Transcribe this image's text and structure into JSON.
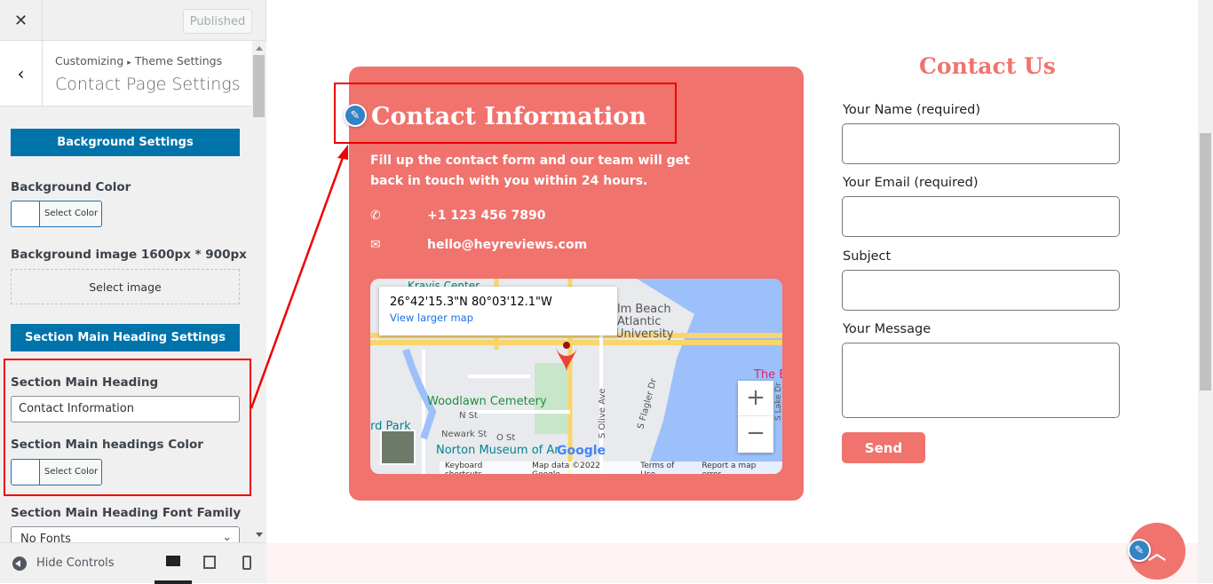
{
  "sidebar": {
    "close_icon": "close-icon",
    "published": "Published",
    "breadcrumb": {
      "root": "Customizing",
      "separator": "▸",
      "parent": "Theme Settings"
    },
    "title": "Contact Page Settings",
    "background_settings": "Background Settings",
    "background_color_label": "Background Color",
    "select_color": "Select Color",
    "background_image_label": "Background image 1600px * 900px",
    "select_image": "Select image",
    "section_heading_settings": "Section Main Heading Settings",
    "section_heading_label": "Section Main Heading",
    "section_heading_value": "Contact Information",
    "section_heading_color_label": "Section Main headings Color",
    "font_family_label": "Section Main Heading Font Family",
    "font_family_value": "No Fonts",
    "hide_controls": "Hide Controls"
  },
  "contact_card": {
    "heading": "Contact Information",
    "description": "Fill up the contact form and our team will get back in touch with you within 24 hours.",
    "phone": "+1 123 456 7890",
    "email": "hello@heyreviews.com",
    "accent": "#f0736d"
  },
  "map": {
    "coords": "26°42'15.3\"N 80°03'12.1\"W",
    "view_larger": "View larger map",
    "labels": [
      "Kravis Center",
      "alm Beach",
      "Atlantic",
      "University",
      "The B",
      "Woodlawn Cemetery",
      "N St",
      "Newark St",
      "O St",
      "rd Park",
      "Norton Museum of Ar",
      "S Olive Ave",
      "S Flagler Dr",
      "S Lake Dr"
    ],
    "google": "Google",
    "footer": [
      "Keyboard shortcuts",
      "Map data ©2022 Google",
      "Terms of Use",
      "Report a map error"
    ],
    "zoom_in": "+",
    "zoom_out": "−"
  },
  "form": {
    "heading": "Contact Us",
    "name_label": "Your Name (required)",
    "email_label": "Your Email (required)",
    "subject_label": "Subject",
    "message_label": "Your Message",
    "send": "Send"
  }
}
